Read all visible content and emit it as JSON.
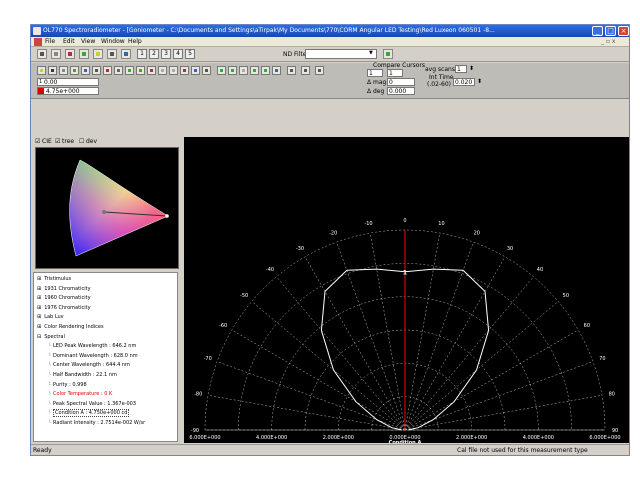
{
  "window": {
    "title": "OL770 Spectroradiometer - [Goniometer - C:\\Documents and Settings\\aTirpak\\My Documents\\770\\CORM Angular LED Testing\\Red Luxeon 060501 -8..."
  },
  "menu": {
    "items": [
      "File",
      "Edit",
      "View",
      "Window",
      "Help"
    ],
    "mdi": "_ &#x2012; x"
  },
  "toolbar": {
    "numbers": [
      "1",
      "2",
      "3",
      "4",
      "5"
    ],
    "nd_filter_label": "ND Filter",
    "nd_filter_value": ""
  },
  "panel": {
    "cursor_value_1": "0.00",
    "cursor_value_2": "4.75e+000",
    "compare_cursors_label": "Compare Cursors",
    "cursor_a": "1",
    "cursor_b": "1",
    "delta_mag_label": "mag",
    "delta_mag_value": "0",
    "delta_deg_label": "deg",
    "delta_deg_value": "0.000",
    "avg_scans_label": "avg scans",
    "avg_scans_value": "1",
    "int_time_label": "Int Time",
    "int_time_range": "(.02-60)",
    "int_time_value": "0.020"
  },
  "chromaticity": {
    "cie_label": "CIE",
    "tree_label": "tree",
    "dev_label": "dev",
    "cie_checked": true,
    "tree_checked": true,
    "dev_checked": false
  },
  "tree": [
    {
      "label": "Tristimulus",
      "level": 0,
      "expand": "+"
    },
    {
      "label": "1931 Chromaticity",
      "level": 0,
      "expand": "+"
    },
    {
      "label": "1960 Chromaticity",
      "level": 0,
      "expand": "+"
    },
    {
      "label": "1976 Chromaticity",
      "level": 0,
      "expand": "+"
    },
    {
      "label": "Lab Luv",
      "level": 0,
      "expand": "+"
    },
    {
      "label": "Color Rendering Indices",
      "level": 0,
      "expand": "+"
    },
    {
      "label": "Spectral",
      "level": 0,
      "expand": "-"
    },
    {
      "label": "LED Peak Wavelength : 646.2 nm",
      "level": 1
    },
    {
      "label": "Dominant Wavelength : 628.0 nm",
      "level": 1
    },
    {
      "label": "Center Wavelength : 644.4 nm",
      "level": 1
    },
    {
      "label": "Half Bandwidth : 22.1 nm",
      "level": 1
    },
    {
      "label": "Purity : 0.998",
      "level": 1
    },
    {
      "label": "Color Temperature : 0 K",
      "level": 1,
      "red": true
    },
    {
      "label": "Peak Spectral Value : 1.367e-003",
      "level": 1
    },
    {
      "label": "Condition A : 4.750e+000 cd",
      "level": 1,
      "selected": true
    },
    {
      "label": "Radiant Intensity : 2.7514e-002 W/sr",
      "level": 1
    }
  ],
  "polar": {
    "angle_labels": [
      "-90",
      "-80",
      "-70",
      "-60",
      "-50",
      "-40",
      "-30",
      "-20",
      "-10",
      "0",
      "10",
      "20",
      "30",
      "40",
      "50",
      "60",
      "70",
      "80",
      "90"
    ],
    "radial_labels": [
      "6.000E+000",
      "4.000E+000",
      "2.000E+000",
      "0.000E+000",
      "2.000E+000",
      "4.000E+000",
      "6.000E+000"
    ],
    "axis_title": "Condition A",
    "cursor_label": "1",
    "r_max": 6.0,
    "pattern_deg": [
      -90,
      -80,
      -70,
      -60,
      -50,
      -40,
      -30,
      -20,
      -10,
      0,
      10,
      20,
      30,
      40,
      50,
      60,
      70,
      80,
      90
    ],
    "pattern_value": [
      0.1,
      0.4,
      0.9,
      1.7,
      2.8,
      3.9,
      4.8,
      5.1,
      4.9,
      4.75,
      4.9,
      5.1,
      4.8,
      3.9,
      2.8,
      1.7,
      0.9,
      0.4,
      0.1
    ]
  },
  "status": {
    "left": "Ready",
    "right": "Cal file not used for this measurement type"
  },
  "colors": {
    "title_bar": "#1845b8",
    "plot_bg": "#000000",
    "pattern": "#ffffff",
    "cursor": "#ff0000"
  }
}
